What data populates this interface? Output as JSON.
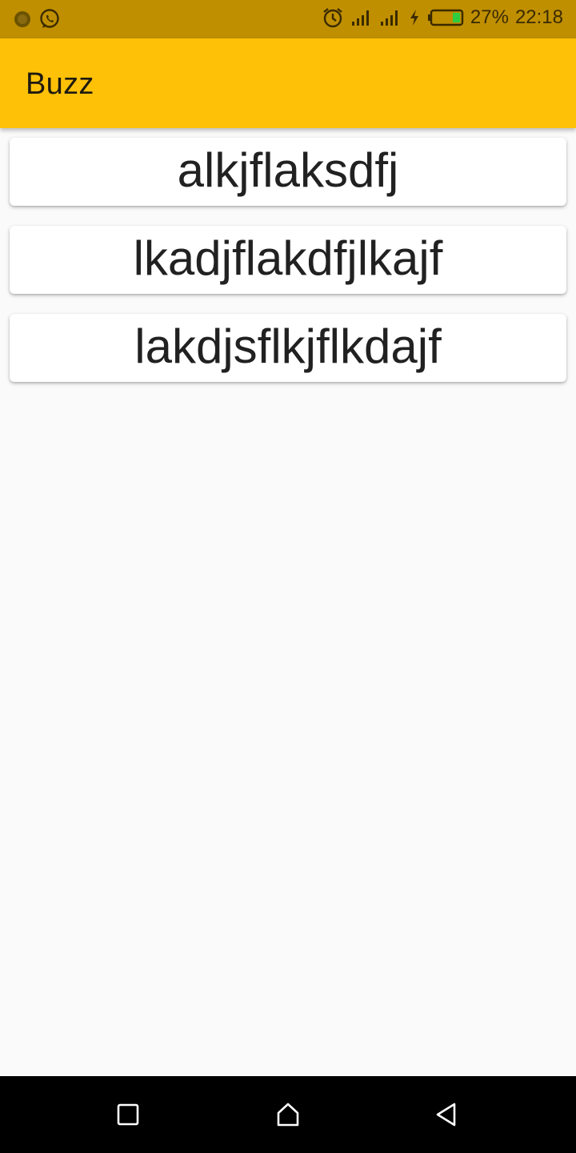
{
  "status_bar": {
    "battery_percent": "27%",
    "time": "22:18",
    "icons": [
      "notification-app-icon",
      "whatsapp-icon",
      "alarm-icon",
      "signal-icon",
      "signal-icon",
      "charging-icon",
      "battery-icon"
    ]
  },
  "app_bar": {
    "title": "Buzz"
  },
  "list": {
    "items": [
      {
        "label": "alkjflaksdfj"
      },
      {
        "label": "lkadjflakdfjlkajf"
      },
      {
        "label": "lakdjsflkjflkdajf"
      }
    ]
  },
  "nav_bar": {
    "icons": [
      "recent-apps-icon",
      "home-icon",
      "back-icon"
    ]
  },
  "colors": {
    "status_bar": "#bf8f00",
    "app_bar": "#ffc107",
    "background": "#fafafa",
    "nav_bar": "#000000"
  }
}
